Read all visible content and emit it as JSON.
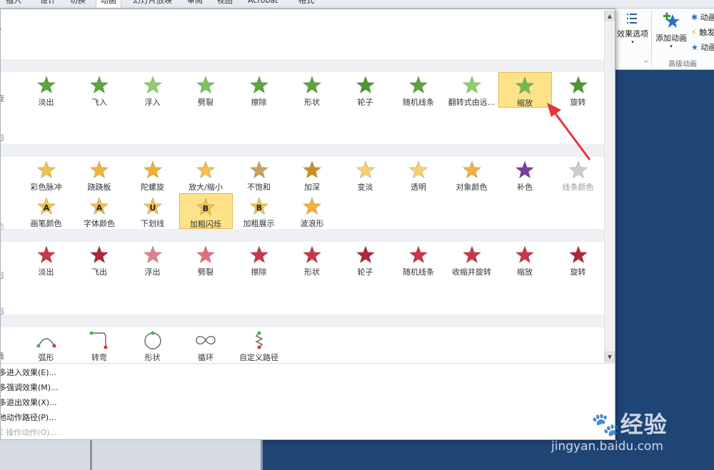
{
  "ribbon": {
    "tabs": [
      "插入",
      "设计",
      "切换",
      "动画",
      "幻灯片放映",
      "审阅",
      "视图",
      "Acrobat",
      "格式"
    ],
    "effect_options_label": "效果选项",
    "add_animation_label": "添加动画",
    "small_buttons": [
      "动画",
      "触发",
      "动画"
    ],
    "group_label": "高级动画",
    "dialog_launcher": "⌐"
  },
  "entrance": [
    {
      "label": "淡出",
      "color": "#5aa63a"
    },
    {
      "label": "飞入",
      "color": "#5aa63a"
    },
    {
      "label": "浮入",
      "color": "#8ccf6e"
    },
    {
      "label": "劈裂",
      "color": "#7cc35a"
    },
    {
      "label": "擦除",
      "color": "#5aa63a"
    },
    {
      "label": "形状",
      "color": "#5aa63a"
    },
    {
      "label": "轮子",
      "color": "#4a9a2e"
    },
    {
      "label": "随机线条",
      "color": "#5aa63a"
    },
    {
      "label": "翻转式由远...",
      "color": "#8ccf6e"
    },
    {
      "label": "缩放",
      "color": "#6dbb4c"
    },
    {
      "label": "旋转",
      "color": "#4a9a2e"
    }
  ],
  "emphasis_row1": [
    {
      "label": "彩色脉冲",
      "color": "#f2c14e"
    },
    {
      "label": "跷跷板",
      "color": "#f2b13e"
    },
    {
      "label": "陀螺旋",
      "color": "#f0b030"
    },
    {
      "label": "放大/缩小",
      "color": "#f2c14e"
    },
    {
      "label": "不饱和",
      "color": "#c9a25a"
    },
    {
      "label": "加深",
      "color": "#c8901e"
    },
    {
      "label": "变淡",
      "color": "#f5cf6b"
    },
    {
      "label": "透明",
      "color": "#f5cf6b"
    },
    {
      "label": "对象颜色",
      "color": "#f2b13e"
    },
    {
      "label": "补色",
      "color": "#7b3fa0"
    },
    {
      "label": "线条颜色",
      "color": "#cccccc"
    }
  ],
  "emphasis_row2": [
    {
      "label": "画笔颜色",
      "letter": "A",
      "color": "#f2c14e"
    },
    {
      "label": "字体颜色",
      "letter": "A",
      "color": "#f2c14e"
    },
    {
      "label": "下划线",
      "letter": "U",
      "color": "#f2c14e"
    },
    {
      "label": "加粗闪烁",
      "letter": "B",
      "color": "#f2c14e"
    },
    {
      "label": "加粗展示",
      "letter": "B",
      "color": "#f2c14e"
    },
    {
      "label": "波浪形",
      "letter": "",
      "color": "#f2b13e"
    }
  ],
  "exit": [
    {
      "label": "淡出",
      "color": "#c8384a"
    },
    {
      "label": "飞出",
      "color": "#b0283a"
    },
    {
      "label": "浮出",
      "color": "#e08090"
    },
    {
      "label": "劈裂",
      "color": "#e07080"
    },
    {
      "label": "擦除",
      "color": "#c8384a"
    },
    {
      "label": "形状",
      "color": "#c8384a"
    },
    {
      "label": "轮子",
      "color": "#b0283a"
    },
    {
      "label": "随机线条",
      "color": "#c8384a"
    },
    {
      "label": "收缩并旋转",
      "color": "#c8384a"
    },
    {
      "label": "缩放",
      "color": "#c8384a"
    },
    {
      "label": "旋转",
      "color": "#b0283a"
    }
  ],
  "paths": [
    {
      "label": "弧形"
    },
    {
      "label": "转弯"
    },
    {
      "label": "形状"
    },
    {
      "label": "循环"
    },
    {
      "label": "自定义路径"
    }
  ],
  "edge_fragments": {
    "entrance": "旋",
    "entrance2": "形",
    "emph2": "色",
    "exit": "形",
    "exit2": "形",
    "paths": "线"
  },
  "menu": {
    "items": [
      "更多进入效果(E)...",
      "更多强调效果(M)...",
      "更多退出效果(X)...",
      "其他动作路径(P)...",
      "OLE 操作动作(O)..."
    ]
  },
  "watermark": {
    "logo": "Bai🐾经验",
    "url": "jingyan.baidu.com"
  },
  "colors": {
    "selected_bg": "#fde28a",
    "slide_bg": "#1f4577",
    "arrow": "#e8333a"
  }
}
